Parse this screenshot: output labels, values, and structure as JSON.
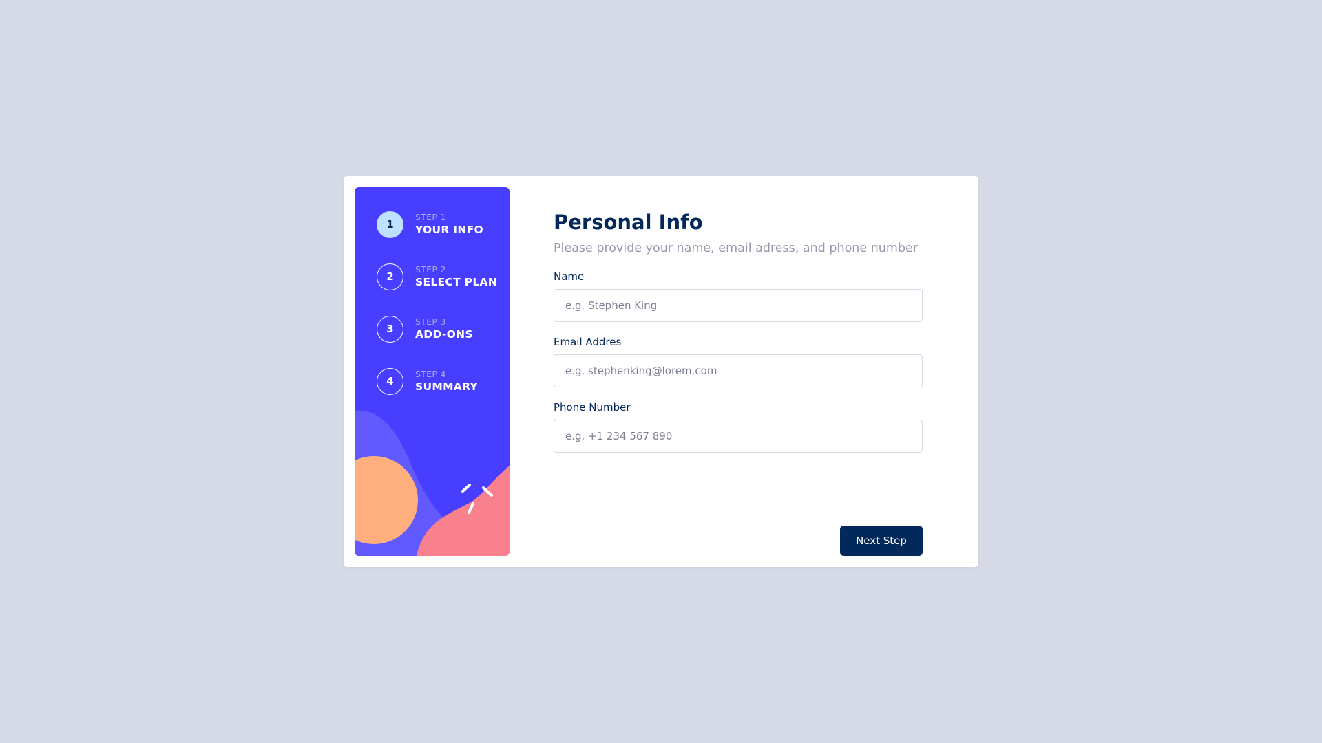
{
  "colors": {
    "page_background": "#d6dae6",
    "card_background": "#ffffff",
    "sidebar_background": "#483eff",
    "active_step": "#bee2fd",
    "primary_text": "#02295a",
    "muted_text": "#9699ab",
    "button": "#02295a",
    "blob_orange": "#ffaf7e",
    "blob_pink": "#f9818e",
    "blob_light": "#6259ff"
  },
  "sidebar": {
    "steps": [
      {
        "number": "1",
        "caption": "STEP 1",
        "title": "YOUR INFO",
        "active": true
      },
      {
        "number": "2",
        "caption": "STEP 2",
        "title": "SELECT PLAN",
        "active": false
      },
      {
        "number": "3",
        "caption": "STEP 3",
        "title": "ADD-ONS",
        "active": false
      },
      {
        "number": "4",
        "caption": "STEP 4",
        "title": "SUMMARY",
        "active": false
      }
    ]
  },
  "main": {
    "title": "Personal Info",
    "subtitle": "Please provide your name, email adress, and phone number",
    "fields": [
      {
        "label": "Name",
        "placeholder": "e.g. Stephen King"
      },
      {
        "label": "Email Addres",
        "placeholder": "e.g. stephenking@lorem.com"
      },
      {
        "label": "Phone Number",
        "placeholder": "e.g. +1 234 567 890"
      }
    ],
    "next_button": "Next Step"
  }
}
